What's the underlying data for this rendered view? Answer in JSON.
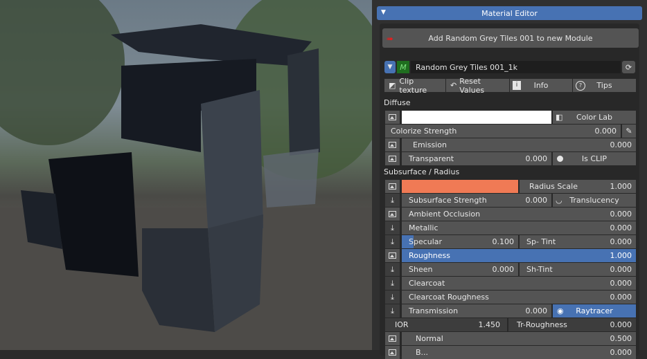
{
  "header": {
    "title": "Material Editor"
  },
  "add_button": {
    "label": "Add Random Grey Tiles 001 to new Module"
  },
  "material": {
    "name": "Random Grey Tiles 001_1k"
  },
  "tools": {
    "clip": "Clip texture",
    "reset": "Reset Values",
    "info": "Info",
    "tips": "Tips"
  },
  "diffuse": {
    "section": "Diffuse",
    "color_lab": "Color Lab",
    "colorize_label": "Colorize Strength",
    "colorize_value": "0.000",
    "emission_label": "Emission",
    "emission_value": "0.000",
    "transparent_label": "Transparent",
    "transparent_value": "0.000",
    "is_clip": "Is CLIP",
    "color": "#ffffff"
  },
  "subsurface": {
    "section": "Subsurface / Radius",
    "color": "#f07a55",
    "radius_label": "Radius Scale",
    "radius_value": "1.000",
    "strength_label": "Subsurface Strength",
    "strength_value": "0.000",
    "translucency": "Translucency"
  },
  "props": {
    "ao_label": "Ambient Occlusion",
    "ao_value": "0.000",
    "metallic_label": "Metallic",
    "metallic_value": "0.000",
    "specular_label": "Specular",
    "specular_value": "0.100",
    "sptint_label": "Sp- Tint",
    "sptint_value": "0.000",
    "roughness_label": "Roughness",
    "roughness_value": "1.000",
    "sheen_label": "Sheen",
    "sheen_value": "0.000",
    "shtint_label": "Sh-Tint",
    "shtint_value": "0.000",
    "clearcoat_label": "Clearcoat",
    "clearcoat_value": "0.000",
    "ccrough_label": "Clearcoat Roughness",
    "ccrough_value": "0.000",
    "transmission_label": "Transmission",
    "transmission_value": "0.000",
    "raytracer": "Raytracer",
    "ior_label": "IOR",
    "ior_value": "1.450",
    "trrough_label": "Tr-Roughness",
    "trrough_value": "0.000",
    "normal_label": "Normal",
    "normal_value": "0.500",
    "next_label": "B...",
    "next_value": "0.000"
  },
  "colors": {
    "accent": "#4772b3",
    "panel": "#303030",
    "field": "#545454"
  }
}
